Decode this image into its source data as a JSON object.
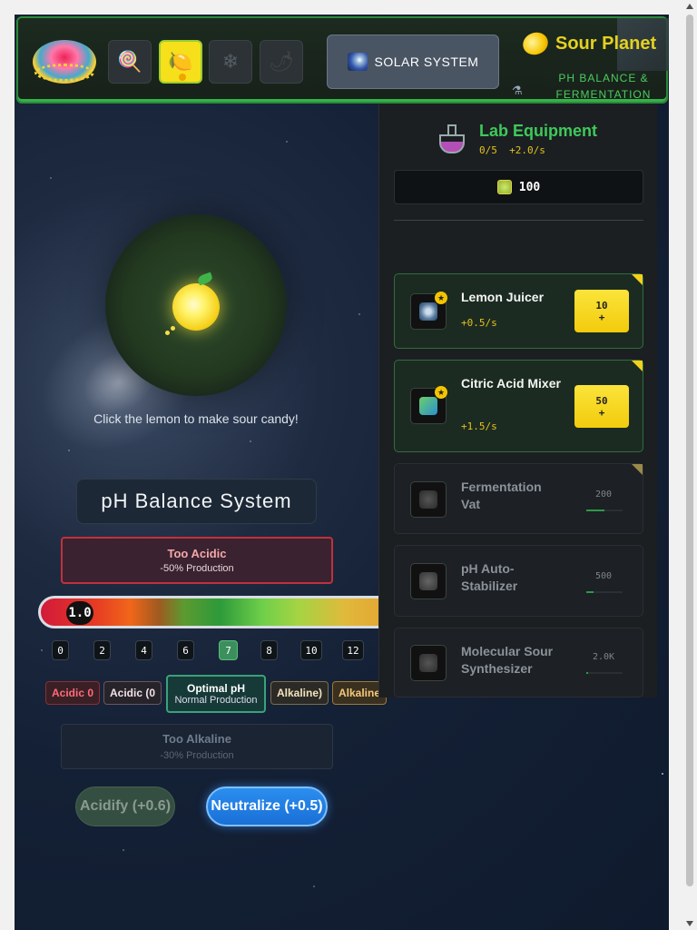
{
  "header": {
    "solar_label": "SOLAR SYSTEM",
    "planet_name": "Sour Planet",
    "subtitle": "PH BALANCE & FERMENTATION LABORATORY",
    "planets": [
      "candy-planet",
      "sour-planet",
      "ice-planet",
      "spicy-planet"
    ],
    "active_planet": "sour-planet"
  },
  "game": {
    "hint": "Click the lemon to make sour candy!"
  },
  "ph": {
    "title": "pH Balance System",
    "acidic_title": "Too Acidic",
    "acidic_sub": "-50% Production",
    "alkaline_title": "Too Alkaline",
    "alkaline_sub": "-30% Production",
    "value": "1.0",
    "ticks": [
      "0",
      "2",
      "4",
      "6",
      "7",
      "8",
      "10",
      "12"
    ],
    "zones": {
      "acid1": "Acidic 0",
      "acid2": "Acidic (0",
      "optimal_title": "Optimal pH",
      "optimal_sub": "Normal Production",
      "alk1": "Alkaline)",
      "alk2": "Alkaline"
    },
    "acidify_label": "Acidify (+0.6)",
    "neutralize_label": "Neutralize (+0.5)"
  },
  "lab": {
    "title": "Lab Equipment",
    "owned": "0/5",
    "rate": "+2.0/s",
    "coins": "100",
    "items": [
      {
        "name": "Lemon Juicer",
        "rate": "+0.5/s",
        "cost": "10",
        "plus": "+",
        "state": "affordable"
      },
      {
        "name": "Citric Acid Mixer",
        "rate": "+1.5/s",
        "cost": "50",
        "plus": "+",
        "state": "affordable"
      },
      {
        "name": "Fermentation Vat",
        "cost": "200",
        "progress": 0.5,
        "state": "locked"
      },
      {
        "name": "pH Auto-Stabilizer",
        "cost": "500",
        "progress": 0.2,
        "state": "locked"
      },
      {
        "name": "Molecular Sour Synthesizer",
        "cost": "2.0K",
        "progress": 0.05,
        "state": "locked"
      }
    ]
  },
  "colors": {
    "accent_green": "#3fc95a",
    "accent_yellow": "#f2d11c",
    "acid_red": "#c0313c",
    "optimal": "#3aa27a",
    "neutralize_blue": "#1a6fd6"
  }
}
